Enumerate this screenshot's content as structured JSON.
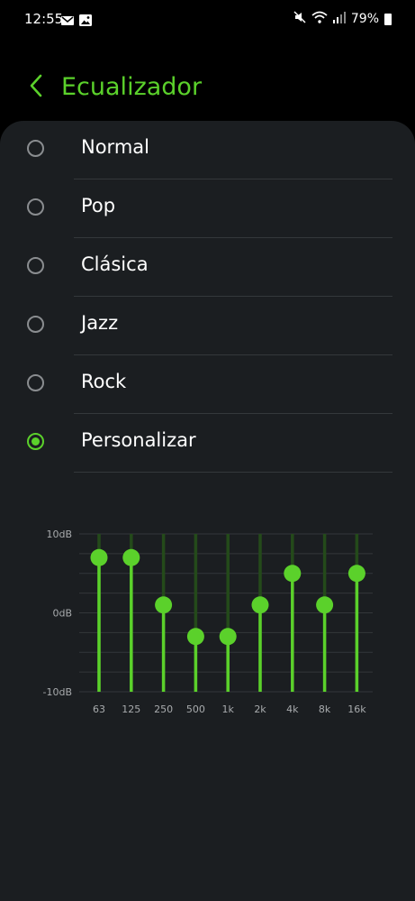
{
  "status": {
    "time": "12:55",
    "battery": "79%",
    "left_icons": [
      "mail-icon",
      "image-icon"
    ],
    "right_icons": [
      "mute-icon",
      "wifi-icon",
      "signal-icon",
      "battery-icon"
    ]
  },
  "header": {
    "title": "Ecualizador",
    "back_icon": "chevron-left-icon"
  },
  "presets": [
    {
      "label": "Normal",
      "selected": false
    },
    {
      "label": "Pop",
      "selected": false
    },
    {
      "label": "Clásica",
      "selected": false
    },
    {
      "label": "Jazz",
      "selected": false
    },
    {
      "label": "Rock",
      "selected": false
    },
    {
      "label": "Personalizar",
      "selected": true
    }
  ],
  "equalizer": {
    "y_labels": [
      "10dB",
      "0dB",
      "-10dB"
    ],
    "ylim": [
      -10,
      10
    ],
    "bands": [
      "63",
      "125",
      "250",
      "500",
      "1k",
      "2k",
      "4k",
      "8k",
      "16k"
    ],
    "values_db": [
      7,
      7,
      1,
      -3,
      -3,
      1,
      5,
      1,
      5
    ]
  },
  "colors": {
    "accent": "#5bd12b",
    "card_background": "#1b1e21",
    "background": "#000000"
  }
}
